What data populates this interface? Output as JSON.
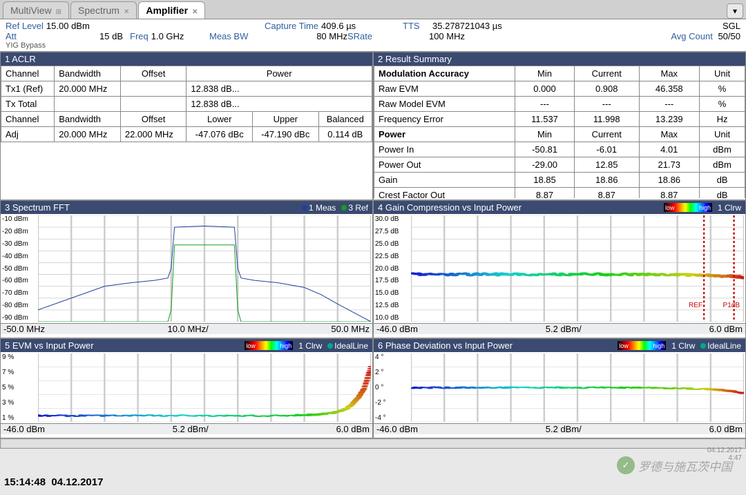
{
  "tabs": [
    {
      "label": "MultiView",
      "active": false
    },
    {
      "label": "Spectrum",
      "active": false
    },
    {
      "label": "Amplifier",
      "active": true
    }
  ],
  "header": {
    "ref_level_lbl": "Ref Level",
    "ref_level": "15.00 dBm",
    "capture_time_lbl": "Capture Time",
    "capture_time": "409.6 µs",
    "tts_lbl": "TTS",
    "tts": "35.278721043 µs",
    "sgl": "SGL",
    "att_lbl": "Att",
    "att": "15 dB",
    "freq_lbl": "Freq",
    "freq": "1.0 GHz",
    "meas_bw_lbl": "Meas BW",
    "meas_bw": "80 MHz",
    "srate_lbl": "SRate",
    "srate": "100 MHz",
    "avg_count_lbl": "Avg Count",
    "avg_count": "50/50",
    "yig": "YIG Bypass"
  },
  "aclr": {
    "title": "1 ACLR",
    "h_channel": "Channel",
    "h_bw": "Bandwidth",
    "h_offset": "Offset",
    "h_power": "Power",
    "tx1_ch": "Tx1 (Ref)",
    "tx1_bw": "20.000 MHz",
    "tx1_pw": "12.838 dB...",
    "txt_ch": "Tx Total",
    "txt_pw": "12.838 dB...",
    "h_lower": "Lower",
    "h_upper": "Upper",
    "h_bal": "Balanced",
    "adj_ch": "Adj",
    "adj_bw": "20.000 MHz",
    "adj_off": "22.000 MHz",
    "adj_low": "-47.076 dBc",
    "adj_up": "-47.190 dBc",
    "adj_bal": "0.114 dB"
  },
  "result": {
    "title": "2 Result Summary",
    "h_mod": "Modulation Accuracy",
    "h_min": "Min",
    "h_cur": "Current",
    "h_max": "Max",
    "h_unit": "Unit",
    "rows1": [
      {
        "n": "Raw EVM",
        "min": "0.000",
        "cur": "0.908",
        "max": "46.358",
        "u": "%"
      },
      {
        "n": "Raw Model EVM",
        "min": "---",
        "cur": "---",
        "max": "---",
        "u": "%"
      },
      {
        "n": "Frequency Error",
        "min": "11.537",
        "cur": "11.998",
        "max": "13.239",
        "u": "Hz"
      }
    ],
    "h_pow": "Power",
    "rows2": [
      {
        "n": "Power In",
        "min": "-50.81",
        "cur": "-6.01",
        "max": "4.01",
        "u": "dBm"
      },
      {
        "n": "Power Out",
        "min": "-29.00",
        "cur": "12.85",
        "max": "21.73",
        "u": "dBm"
      },
      {
        "n": "Gain",
        "min": "18.85",
        "cur": "18.86",
        "max": "18.86",
        "u": "dB"
      },
      {
        "n": "Crest Factor Out",
        "min": "8.87",
        "cur": "8.87",
        "max": "8.87",
        "u": "dB"
      }
    ]
  },
  "spectrum": {
    "title": "3 Spectrum FFT",
    "leg1": "1 Meas",
    "leg2": "3 Ref",
    "ylabels": [
      "-10 dBm",
      "-20 dBm",
      "-30 dBm",
      "-40 dBm",
      "-50 dBm",
      "-60 dBm",
      "-70 dBm",
      "-80 dBm",
      "-90 dBm"
    ],
    "xmin": "-50.0 MHz",
    "xstep": "10.0 MHz/",
    "xmax": "50.0 MHz"
  },
  "gain": {
    "title": "4 Gain Compression vs Input Power",
    "leg_low": "low",
    "leg_high": "high",
    "leg_clrw": "1 Clrw",
    "ylabels": [
      "30.0 dB",
      "27.5 dB",
      "25.0 dB",
      "22.5 dB",
      "20.0 dB",
      "17.5 dB",
      "15.0 dB",
      "12.5 dB",
      "10.0 dB"
    ],
    "xmin": "-46.0 dBm",
    "xstep": "5.2 dBm/",
    "xmax": "6.0 dBm",
    "ref": "REF",
    "p1db": "P1dB"
  },
  "evm": {
    "title": "5 EVM vs Input Power",
    "leg_low": "low",
    "leg_high": "high",
    "leg_clrw": "1 Clrw",
    "leg_ideal": "IdealLine",
    "ylabels": [
      "9 %",
      "7 %",
      "5 %",
      "3 %",
      "1 %"
    ],
    "xmin": "-46.0 dBm",
    "xstep": "5.2 dBm/",
    "xmax": "6.0 dBm"
  },
  "phase": {
    "title": "6 Phase Deviation vs Input Power",
    "leg_low": "low",
    "leg_high": "high",
    "leg_clrw": "1 Clrw",
    "leg_ideal": "IdealLine",
    "ylabels": [
      "4 °",
      "2 °",
      "0 °",
      "-2 °",
      "-4 °"
    ],
    "xmin": "-46.0 dBm",
    "xstep": "5.2 dBm/",
    "xmax": "6.0 dBm"
  },
  "footer": {
    "time": "15:14:48",
    "date": "04.12.2017",
    "date2": "04.12.2017",
    "time2": "4:47"
  },
  "watermark": "罗德与施瓦茨中国",
  "chart_data": {
    "spectrum_fft": {
      "type": "line",
      "xlabel": "MHz",
      "ylabel": "dBm",
      "xlim": [
        -50,
        50
      ],
      "ylim": [
        -95,
        -5
      ],
      "series": [
        {
          "name": "1 Meas",
          "color": "#2040a0",
          "x": [
            -50,
            -40,
            -35,
            -30,
            -22,
            -15,
            -11,
            -10,
            -9,
            0,
            9,
            10,
            11,
            15,
            22,
            30,
            35,
            40,
            50
          ],
          "y": [
            -85,
            -75,
            -70,
            -65,
            -62,
            -60,
            -58,
            -50,
            -15,
            -14,
            -15,
            -50,
            -58,
            -60,
            -62,
            -66,
            -72,
            -80,
            -95
          ]
        },
        {
          "name": "3 Ref",
          "color": "#10a020",
          "x": [
            -50,
            -11,
            -10,
            -9,
            0,
            9,
            10,
            11,
            50
          ],
          "y": [
            -95,
            -95,
            -85,
            -30,
            -30,
            -30,
            -85,
            -95,
            -95
          ]
        }
      ]
    },
    "gain_compression": {
      "type": "scatter",
      "xlabel": "dBm",
      "ylabel": "dB",
      "xlim": [
        -46,
        6
      ],
      "ylim": [
        9,
        31
      ],
      "annotations": [
        "REF",
        "P1dB"
      ],
      "x": [
        -46,
        -40,
        -34,
        -28,
        -22,
        -16,
        -10,
        -4,
        0,
        4,
        6
      ],
      "y": [
        18.8,
        18.8,
        18.8,
        18.8,
        18.8,
        18.8,
        18.8,
        18.7,
        18.6,
        18.4,
        18.2
      ]
    },
    "evm_vs_input": {
      "type": "scatter",
      "xlabel": "dBm",
      "ylabel": "%",
      "xlim": [
        -46,
        6
      ],
      "ylim": [
        0,
        10
      ],
      "x": [
        -46,
        -40,
        -34,
        -28,
        -22,
        -16,
        -10,
        -4,
        -2,
        0,
        2,
        3,
        4,
        5,
        6
      ],
      "y": [
        0.9,
        0.9,
        0.9,
        0.9,
        0.9,
        0.9,
        0.9,
        1.0,
        1.1,
        1.3,
        1.8,
        2.5,
        3.5,
        5.0,
        8.0
      ]
    },
    "phase_deviation": {
      "type": "scatter",
      "xlabel": "dBm",
      "ylabel": "deg",
      "xlim": [
        -46,
        6
      ],
      "ylim": [
        -5,
        5
      ],
      "x": [
        -46,
        -40,
        -34,
        -28,
        -22,
        -16,
        -10,
        -4,
        0,
        2,
        4,
        6
      ],
      "y": [
        0,
        0,
        0,
        0,
        0,
        0,
        0,
        -0.1,
        -0.2,
        -0.3,
        -0.5,
        -0.8
      ]
    }
  }
}
